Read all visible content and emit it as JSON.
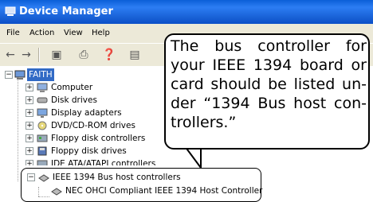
{
  "window": {
    "title": "Device Manager",
    "title_icon": "computer-icon"
  },
  "menu": [
    "File",
    "Action",
    "View",
    "Help"
  ],
  "toolbar": {
    "icons": [
      "back-arrow-icon",
      "forward-arrow-icon",
      "properties-view-icon",
      "print-icon",
      "help-icon",
      "scan-icon"
    ]
  },
  "tree": {
    "root": "FAITH",
    "items": [
      {
        "label": "Computer",
        "icon": "computer-icon"
      },
      {
        "label": "Disk drives",
        "icon": "disk-drive-icon"
      },
      {
        "label": "Display adapters",
        "icon": "display-adapter-icon"
      },
      {
        "label": "DVD/CD-ROM drives",
        "icon": "cdrom-icon"
      },
      {
        "label": "Floppy disk controllers",
        "icon": "floppy-controller-icon"
      },
      {
        "label": "Floppy disk drives",
        "icon": "floppy-drive-icon"
      },
      {
        "label": "IDE ATA/ATAPI controllers",
        "icon": "ide-controller-icon"
      },
      {
        "label": "IEEE 1394 Bus host controllers",
        "icon": "ieee1394-icon"
      }
    ],
    "child": {
      "label": "NEC OHCI Compliant IEEE 1394 Host Controller",
      "icon": "ieee1394-device-icon"
    }
  },
  "callout": {
    "text": "The bus controller for your IEEE 1394 board or card should be listed un-der “1394 Bus host con-trollers.”"
  }
}
